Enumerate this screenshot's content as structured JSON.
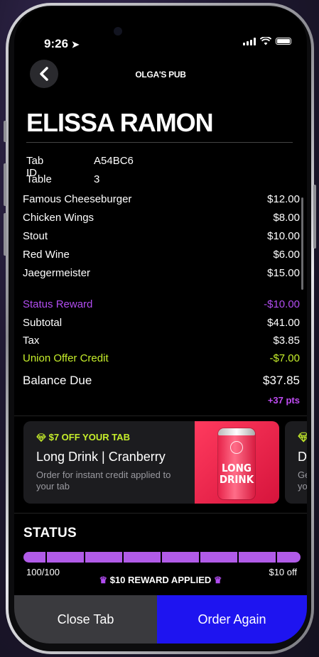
{
  "statusbar": {
    "time": "9:26"
  },
  "header": {
    "venue": "OLGA'S PUB"
  },
  "guest_name": "ELISSA RAMON",
  "tab": {
    "id_label": "Tab ID",
    "id_value": "A54BC6",
    "table_label": "Table",
    "table_value": "3"
  },
  "items": [
    {
      "name": "Famous Cheeseburger",
      "price": "$12.00"
    },
    {
      "name": "Chicken Wings",
      "price": "$8.00"
    },
    {
      "name": "Stout",
      "price": "$10.00"
    },
    {
      "name": "Red Wine",
      "price": "$6.00"
    },
    {
      "name": "Jaegermeister",
      "price": "$15.00"
    }
  ],
  "summary": {
    "status_reward_label": "Status Reward",
    "status_reward_value": "-$10.00",
    "subtotal_label": "Subtotal",
    "subtotal_value": "$41.00",
    "tax_label": "Tax",
    "tax_value": "$3.85",
    "union_label": "Union Offer Credit",
    "union_value": "-$7.00",
    "balance_label": "Balance Due",
    "balance_value": "$37.85",
    "points": "+37 pts"
  },
  "offers": [
    {
      "title": "$7 OFF YOUR TAB",
      "name": "Long Drink | Cranberry",
      "desc": "Order for instant credit applied to your tab",
      "can_text": "LONG\nDRINK"
    },
    {
      "title": "",
      "name": "Do",
      "desc": "Ge\nyou"
    }
  ],
  "status": {
    "heading": "STATUS",
    "progress_fraction": 1.0,
    "progress_text": "100/100",
    "reward_off": "$10 off",
    "reward_applied": "$10 REWARD APPLIED"
  },
  "actions": {
    "close_label": "Close Tab",
    "order_label": "Order Again"
  },
  "colors": {
    "accent_purple": "#b14cf0",
    "accent_lime": "#c6ee2b",
    "order_blue": "#1e14f0"
  }
}
